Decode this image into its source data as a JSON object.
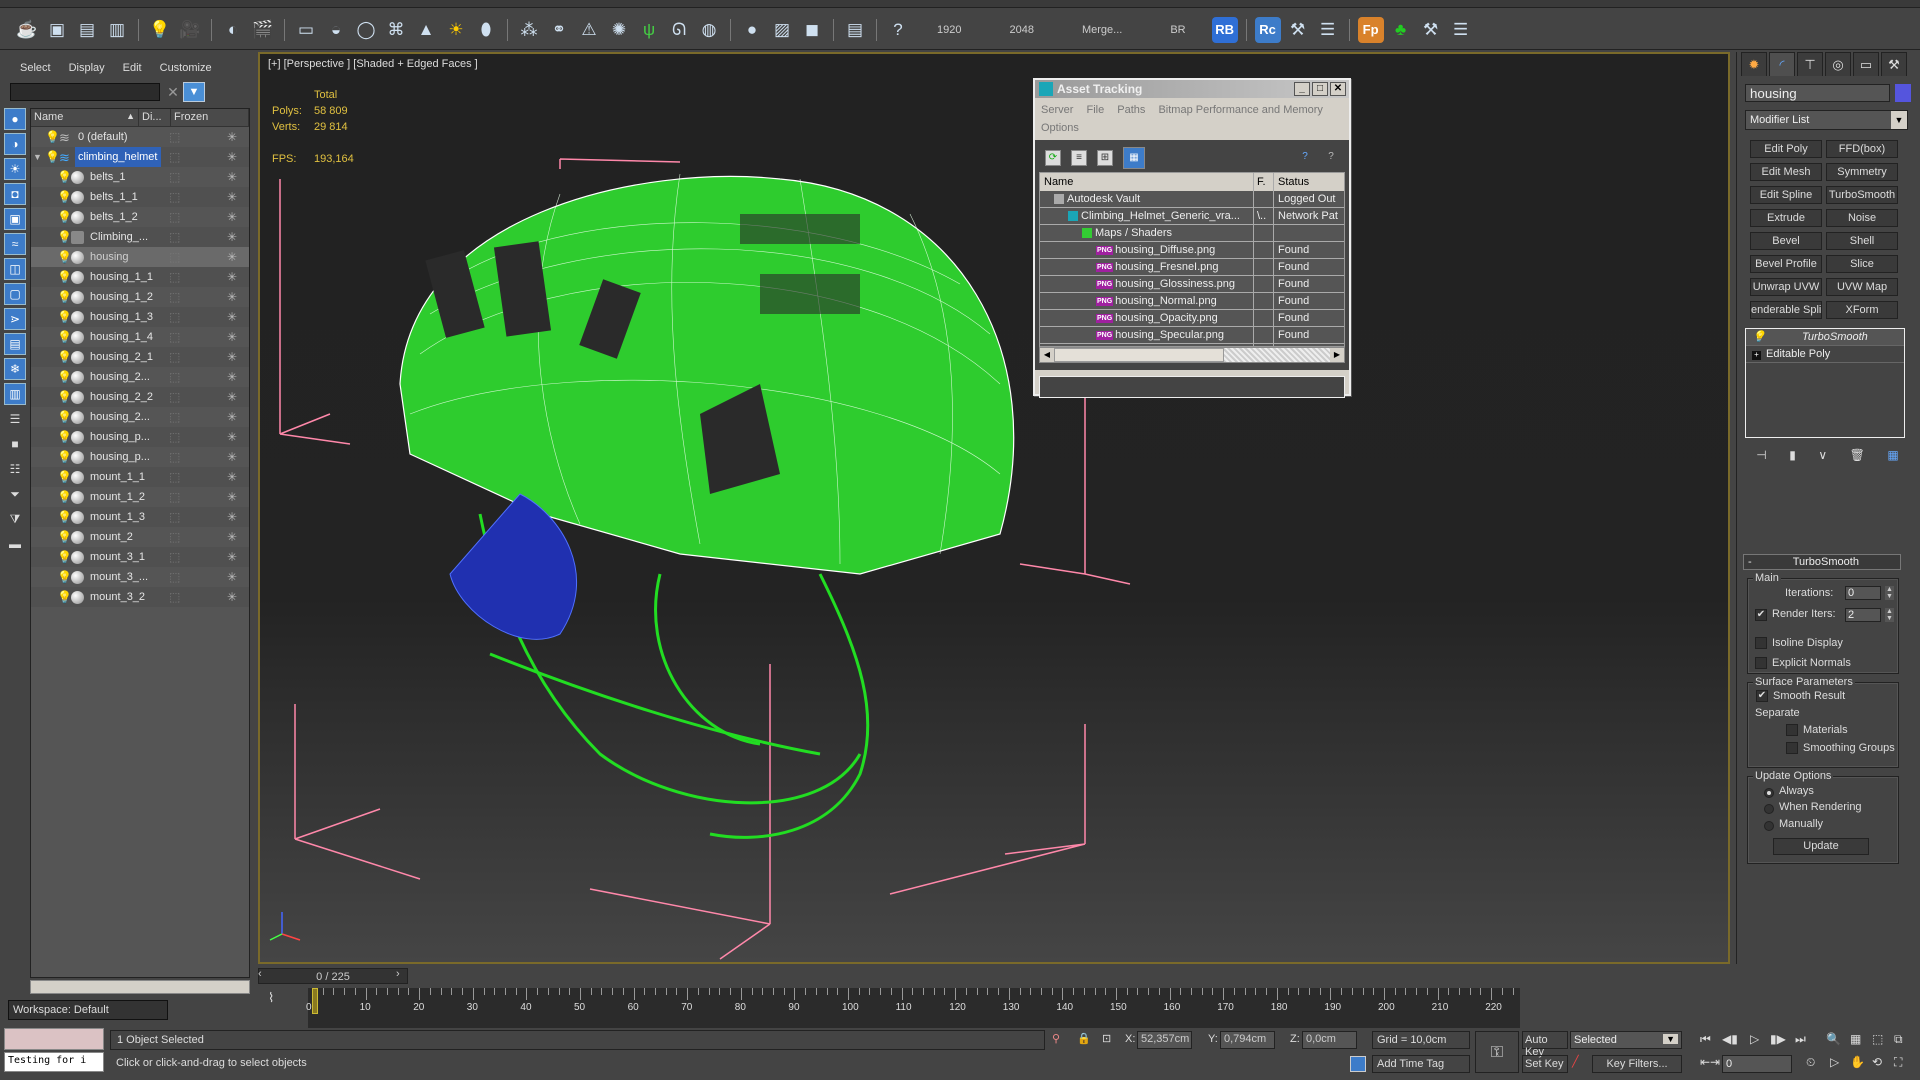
{
  "toolbar": {
    "icons": [
      "teapot-icon",
      "render-frame-icon",
      "render-setup-icon",
      "render-settings-icon",
      "light-lister-icon",
      "camera-icon",
      "camera-target-icon",
      "camera-physical-icon",
      "plane-light-icon",
      "sphere-light-icon",
      "disc-light-icon",
      "mesh-light-icon",
      "cone-light-icon",
      "sun-icon",
      "dome-light-icon",
      "particles-icon",
      "molecule-icon",
      "tower-icon",
      "fur-icon",
      "grass-icon",
      "hair-icon",
      "ox-icon",
      "sphere-icon",
      "bitmap-icon",
      "proxy-icon",
      "batch-icon",
      "help-icon"
    ],
    "texts": [
      "1920",
      "2048",
      "Merge...",
      "BR"
    ],
    "badges": [
      {
        "label": "RB",
        "color": "#2f6fd6"
      },
      {
        "label": "Rc",
        "color": "#3d7cc9"
      },
      {
        "label": "Fp",
        "color": "#d9822b"
      }
    ]
  },
  "scene_explorer": {
    "menu": [
      "Select",
      "Display",
      "Edit",
      "Customize"
    ],
    "search_value": "",
    "columns": [
      "Name",
      "Di...",
      "Frozen"
    ],
    "rows": [
      {
        "name": "0 (default)",
        "level": 0,
        "type": "layer"
      },
      {
        "name": "climbing_helmet",
        "level": 0,
        "type": "layer",
        "selected": true,
        "expanded": true
      },
      {
        "name": "belts_1",
        "level": 1,
        "type": "object"
      },
      {
        "name": "belts_1_1",
        "level": 1,
        "type": "object"
      },
      {
        "name": "belts_1_2",
        "level": 1,
        "type": "object"
      },
      {
        "name": "Climbing_...",
        "level": 1,
        "type": "group"
      },
      {
        "name": "housing",
        "level": 1,
        "type": "object",
        "highlighted": true
      },
      {
        "name": "housing_1_1",
        "level": 1,
        "type": "object"
      },
      {
        "name": "housing_1_2",
        "level": 1,
        "type": "object"
      },
      {
        "name": "housing_1_3",
        "level": 1,
        "type": "object"
      },
      {
        "name": "housing_1_4",
        "level": 1,
        "type": "object"
      },
      {
        "name": "housing_2_1",
        "level": 1,
        "type": "object"
      },
      {
        "name": "housing_2...",
        "level": 1,
        "type": "object"
      },
      {
        "name": "housing_2_2",
        "level": 1,
        "type": "object"
      },
      {
        "name": "housing_2...",
        "level": 1,
        "type": "object"
      },
      {
        "name": "housing_p...",
        "level": 1,
        "type": "object"
      },
      {
        "name": "housing_p...",
        "level": 1,
        "type": "object"
      },
      {
        "name": "mount_1_1",
        "level": 1,
        "type": "object"
      },
      {
        "name": "mount_1_2",
        "level": 1,
        "type": "object"
      },
      {
        "name": "mount_1_3",
        "level": 1,
        "type": "object"
      },
      {
        "name": "mount_2",
        "level": 1,
        "type": "object"
      },
      {
        "name": "mount_3_1",
        "level": 1,
        "type": "object"
      },
      {
        "name": "mount_3_...",
        "level": 1,
        "type": "object"
      },
      {
        "name": "mount_3_2",
        "level": 1,
        "type": "object"
      }
    ],
    "workspace": "Workspace: Default"
  },
  "viewport": {
    "label": "[+] [Perspective ] [Shaded + Edged Faces ]",
    "stats": {
      "total_label": "Total",
      "polys_label": "Polys:",
      "polys": "58 809",
      "verts_label": "Verts:",
      "verts": "29 814",
      "fps_label": "FPS:",
      "fps": "193,164"
    }
  },
  "asset_tracking": {
    "title": "Asset Tracking",
    "menu": [
      "Server",
      "File",
      "Paths",
      "Bitmap Performance and Memory",
      "Options"
    ],
    "columns": [
      "Name",
      "F.",
      "Status"
    ],
    "rows": [
      {
        "name": "Autodesk Vault",
        "f": "",
        "status": "Logged Out",
        "indent": 1,
        "icon": "vault-icon"
      },
      {
        "name": "Climbing_Helmet_Generic_vra...",
        "f": "\\..",
        "status": "Network Pat",
        "indent": 2,
        "icon": "max-file-icon"
      },
      {
        "name": "Maps / Shaders",
        "f": "",
        "status": "",
        "indent": 3,
        "icon": "maps-icon"
      },
      {
        "name": "housing_Diffuse.png",
        "f": "",
        "status": "Found",
        "indent": 4,
        "icon": "png-icon"
      },
      {
        "name": "housing_FresneI.png",
        "f": "",
        "status": "Found",
        "indent": 4,
        "icon": "png-icon"
      },
      {
        "name": "housing_Glossiness.png",
        "f": "",
        "status": "Found",
        "indent": 4,
        "icon": "png-icon"
      },
      {
        "name": "housing_Normal.png",
        "f": "",
        "status": "Found",
        "indent": 4,
        "icon": "png-icon"
      },
      {
        "name": "housing_Opacity.png",
        "f": "",
        "status": "Found",
        "indent": 4,
        "icon": "png-icon"
      },
      {
        "name": "housing_Specular.png",
        "f": "",
        "status": "Found",
        "indent": 4,
        "icon": "png-icon"
      }
    ]
  },
  "command_panel": {
    "object_name": "housing",
    "object_color": "#5555dd",
    "modifier_list": "Modifier List",
    "modifier_buttons": [
      "Edit Poly",
      "FFD(box)",
      "Edit Mesh",
      "Symmetry",
      "Edit Spline",
      "TurboSmooth",
      "Extrude",
      "Noise",
      "Bevel",
      "Shell",
      "Bevel Profile",
      "Slice",
      "Unwrap UVW",
      "UVW Map",
      "enderable Splin",
      "XForm"
    ],
    "stack": [
      "TurboSmooth",
      "Editable Poly"
    ],
    "rollout": {
      "title": "TurboSmooth",
      "main_label": "Main",
      "iterations_label": "Iterations:",
      "iterations": "0",
      "render_iters_label": "Render Iters:",
      "render_iters": "2",
      "render_iters_checked": true,
      "isoline_label": "Isoline Display",
      "isoline_checked": false,
      "explicit_label": "Explicit Normals",
      "explicit_checked": false,
      "surface_label": "Surface Parameters",
      "smooth_result_label": "Smooth Result",
      "smooth_result_checked": true,
      "separate_label": "Separate",
      "materials_label": "Materials",
      "smoothing_groups_label": "Smoothing Groups",
      "update_options_label": "Update Options",
      "always_label": "Always",
      "when_rendering_label": "When Rendering",
      "manually_label": "Manually",
      "update_mode": "Always",
      "update_button": "Update"
    }
  },
  "timeline": {
    "slider": "0 / 225",
    "ticks": [
      "0",
      "10",
      "20",
      "30",
      "40",
      "50",
      "60",
      "70",
      "80",
      "90",
      "100",
      "110",
      "120",
      "130",
      "140",
      "150",
      "160",
      "170",
      "180",
      "190",
      "200",
      "210",
      "220"
    ]
  },
  "status": {
    "maxscript": "Testing for i",
    "selection": "1 Object Selected",
    "prompt": "Click or click-and-drag to select objects",
    "x_label": "X:",
    "x": "52,357cm",
    "y_label": "Y:",
    "y": "0,794cm",
    "z_label": "Z:",
    "z": "0,0cm",
    "grid": "Grid = 10,0cm",
    "add_time_tag": "Add Time Tag",
    "auto_key": "Auto Key",
    "set_key": "Set Key",
    "selection_set": "Selected",
    "key_filters": "Key Filters...",
    "current_frame": "0"
  }
}
